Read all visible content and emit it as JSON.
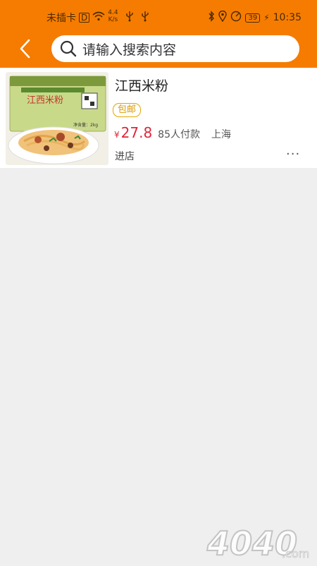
{
  "status_bar": {
    "carrier": "未插卡",
    "speed_value": "4.4",
    "speed_unit": "K/s",
    "battery": "39",
    "time": "10:35"
  },
  "search": {
    "placeholder": "请输入搜索内容"
  },
  "product": {
    "title": "江西米粉",
    "badge": "包邮",
    "currency": "¥",
    "price": "27.8",
    "sales": "85人付款",
    "location": "上海",
    "store_link": "进店",
    "more": "···",
    "image_label": "江西米粉",
    "image_weight": "净含量：2kg"
  },
  "watermark": {
    "text": "4040",
    "suffix": ".com"
  },
  "colors": {
    "header": "#f57c00",
    "price": "#e2243b",
    "badge": "#e0a800"
  }
}
